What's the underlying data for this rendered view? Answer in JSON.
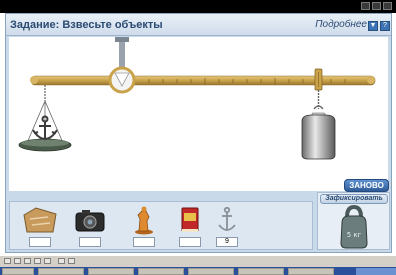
{
  "window": {
    "title": ""
  },
  "task": {
    "title": "Задание: Взвесьте объекты",
    "details_label": "Подробнее"
  },
  "buttons": {
    "reset_label": "ЗАНОВО",
    "fix_label": "Зафиксировать",
    "dropdown_icon": "chevron-down-icon",
    "help_icon": "help-icon"
  },
  "reference_weight": {
    "label": "5 кг"
  },
  "tray": {
    "items": [
      {
        "name": "sack",
        "icon": "sack-icon",
        "value": ""
      },
      {
        "name": "camera",
        "icon": "camera-icon",
        "value": ""
      },
      {
        "name": "figurine",
        "icon": "figurine-icon",
        "value": ""
      },
      {
        "name": "book",
        "icon": "book-icon",
        "value": ""
      },
      {
        "name": "anchor",
        "icon": "anchor-icon",
        "value": "9"
      }
    ]
  },
  "colors": {
    "header_text": "#2a4a72",
    "accent_blue": "#3d73b6",
    "beam_gold": "#c9a24a"
  }
}
